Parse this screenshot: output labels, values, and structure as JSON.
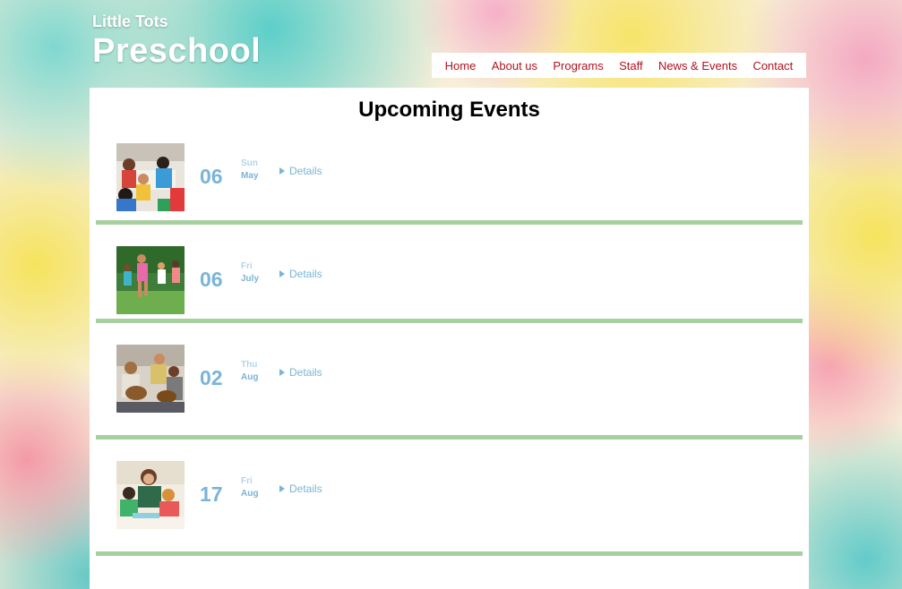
{
  "brand": {
    "small": "Little Tots",
    "big": "Preschool"
  },
  "nav": [
    {
      "label": "Home"
    },
    {
      "label": "About us"
    },
    {
      "label": "Programs"
    },
    {
      "label": "Staff"
    },
    {
      "label": "News & Events"
    },
    {
      "label": "Contact"
    }
  ],
  "page_title": "Upcoming Events",
  "events": [
    {
      "day": "06",
      "weekday": "Sun",
      "month": "May",
      "details": "Details",
      "image": "children-crafting-photo"
    },
    {
      "day": "06",
      "weekday": "Fri",
      "month": "July",
      "details": "Details",
      "image": "children-running-photo"
    },
    {
      "day": "02",
      "weekday": "Thu",
      "month": "Aug",
      "details": "Details",
      "image": "children-guitar-photo"
    },
    {
      "day": "17",
      "weekday": "Fri",
      "month": "Aug",
      "details": "Details",
      "image": "teacher-with-children-photo"
    }
  ],
  "colors": {
    "nav_text": "#b3121d",
    "date_blue": "#7ab4d6",
    "divider_green": "#a8cf9f"
  }
}
